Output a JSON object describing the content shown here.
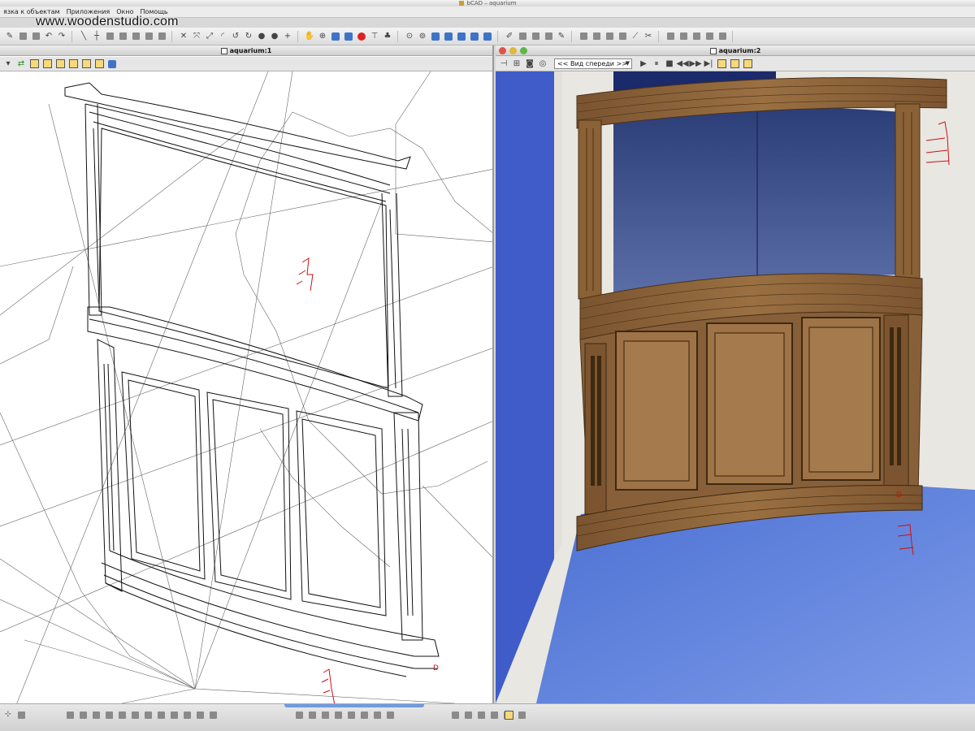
{
  "window": {
    "title": "bCAD – aquarium"
  },
  "watermark": "www.woodenstudio.com",
  "menubar": {
    "items": [
      {
        "label": "язка к объектам"
      },
      {
        "label": "Приложения"
      },
      {
        "label": "Окно"
      },
      {
        "label": "Помощь"
      }
    ]
  },
  "panes": {
    "left": {
      "title": "aquarium:1"
    },
    "right": {
      "title": "aquarium:2",
      "view_select": "<< Вид спереди >>"
    }
  },
  "colors": {
    "wood": "#8b6337",
    "wood_dark": "#5e3f1f",
    "glass": "#4a5c95",
    "floor": "#6f8fe0",
    "wall": "#e9e7e2",
    "window_close": "#e0524a",
    "window_min": "#e0b83a",
    "window_max": "#5cb84a",
    "dimension_marker": "#cc1111"
  },
  "icons": {
    "toolbar": [
      "pencil-icon",
      "copy-icon",
      "undo-icon",
      "redo-icon",
      "line-icon",
      "arc-icon",
      "box-icon",
      "sphere-icon",
      "hand-icon",
      "zoom-icon",
      "pan-icon",
      "rotate-icon",
      "stop-icon",
      "camera-icon",
      "render-icon",
      "zoom-in-icon",
      "zoom-out-icon",
      "view-front-icon",
      "view-side-icon",
      "view-top-icon",
      "layers-icon",
      "settings-icon"
    ]
  },
  "markers": {
    "right_corner_label": "D",
    "left_corner_label": "D"
  }
}
